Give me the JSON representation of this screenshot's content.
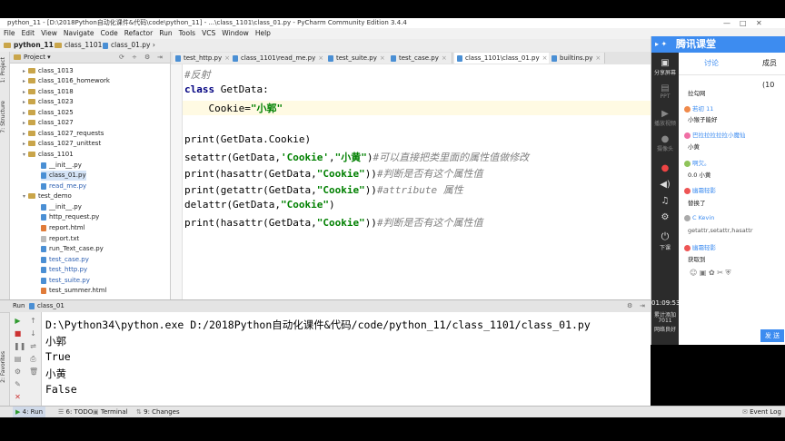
{
  "window": {
    "title": "python_11 - [D:\\2018Python自动化课件&代码\\code\\python_11] - ...\\class_1101\\class_01.py - PyCharm Community Edition 3.4.4"
  },
  "menu": [
    "File",
    "Edit",
    "View",
    "Navigate",
    "Code",
    "Refactor",
    "Run",
    "Tools",
    "VCS",
    "Window",
    "Help"
  ],
  "breadcrumb": [
    "python_11",
    "class_1101",
    "class_01.py"
  ],
  "project_panel": {
    "label": "Project",
    "side_labels": [
      "1: Project",
      "7: Structure",
      "2: Favorites"
    ],
    "items": [
      {
        "name": "class_1013",
        "type": "folder"
      },
      {
        "name": "class_1016_homework",
        "type": "folder"
      },
      {
        "name": "class_1018",
        "type": "folder"
      },
      {
        "name": "class_1023",
        "type": "folder"
      },
      {
        "name": "class_1025",
        "type": "folder"
      },
      {
        "name": "class_1027",
        "type": "folder"
      },
      {
        "name": "class_1027_requests",
        "type": "folder"
      },
      {
        "name": "class_1027_unittest",
        "type": "folder"
      },
      {
        "name": "class_1101",
        "type": "folder"
      },
      {
        "name": "__init__.py",
        "type": "py"
      },
      {
        "name": "class_01.py",
        "type": "py"
      },
      {
        "name": "read_me.py",
        "type": "py"
      },
      {
        "name": "test_demo",
        "type": "folder"
      },
      {
        "name": "__init__.py",
        "type": "py"
      },
      {
        "name": "http_request.py",
        "type": "py"
      },
      {
        "name": "report.html",
        "type": "html"
      },
      {
        "name": "report.txt",
        "type": "txt"
      },
      {
        "name": "run_Text_case.py",
        "type": "py"
      },
      {
        "name": "test_case.py",
        "type": "py"
      },
      {
        "name": "test_http.py",
        "type": "py"
      },
      {
        "name": "test_suite.py",
        "type": "py"
      },
      {
        "name": "test_summer.html",
        "type": "html"
      }
    ]
  },
  "tabs": [
    {
      "label": "test_http.py"
    },
    {
      "label": "class_1101\\read_me.py"
    },
    {
      "label": "test_suite.py"
    },
    {
      "label": "test_case.py"
    },
    {
      "label": "class_1101\\class_01.py",
      "active": true
    },
    {
      "label": "builtins.py"
    }
  ],
  "code": {
    "l1": "#反射",
    "l2_kw": "class",
    "l2_rest": " GetData:",
    "l3_pre": "    Cookie=",
    "l3_str": "\"小郭\"",
    "l5": "print(GetData.Cookie)",
    "l6_pre": "setattr(GetData,",
    "l6_s1": "'Cookie'",
    "l6_mid": ",",
    "l6_s2": "\"小黄\"",
    "l6_post": ")",
    "l6_cm": "#可以直接把类里面的属性值做修改",
    "l7_pre": "print(hasattr(GetData,",
    "l7_str": "\"Cookie\"",
    "l7_post": "))",
    "l7_cm": "#判断是否有这个属性值",
    "l8_pre": "print(getattr(GetData,",
    "l8_str": "\"Cookie\"",
    "l8_post": "))",
    "l8_cm": "#attribute 属性",
    "l9_pre": "delattr(GetData,",
    "l9_str": "\"Cookie\"",
    "l9_post": ")",
    "l10_pre": "print(hasattr(GetData,",
    "l10_str": "\"Cookie\"",
    "l10_post": "))",
    "l10_cm": "#判断是否有这个属性值"
  },
  "run_panel": {
    "label": "Run",
    "config": "class_01",
    "output": [
      "D:\\Python34\\python.exe D:/2018Python自动化课件&代码/code/python_11/class_1101/class_01.py",
      "小郭",
      "True",
      "小黄",
      "False"
    ]
  },
  "bottom_bar": {
    "run": "4: Run",
    "todo": "6: TODO",
    "terminal": "Terminal",
    "changes": "9: Changes",
    "event_log": "Event Log"
  },
  "overlay": {
    "logo": "腾讯课堂",
    "tabs": [
      "讨论",
      "成员(10"
    ],
    "side": [
      "分享屏幕",
      "PPT",
      "播放视频",
      "摄像头",
      "下课"
    ],
    "timer": "01:09:53",
    "stat_label": "累计添加",
    "stat_value": "7011",
    "stat_sub": "网络良好",
    "chat": [
      {
        "name": "",
        "msg": "拉勾网"
      },
      {
        "name": "若初 11",
        "msg": "小猴子能好"
      },
      {
        "name": "巴拉拉拉拉拉小魔仙",
        "msg": "小黄"
      },
      {
        "name": "啊欠。",
        "msg": "0.0 小黄"
      },
      {
        "name": "幽霜轻影",
        "msg": "替换了"
      },
      {
        "name": "C Kevin",
        "msg": "getattr,setattr,hasattr"
      },
      {
        "name": "幽霜轻影",
        "msg": "获取到"
      }
    ],
    "send": "发 送"
  }
}
